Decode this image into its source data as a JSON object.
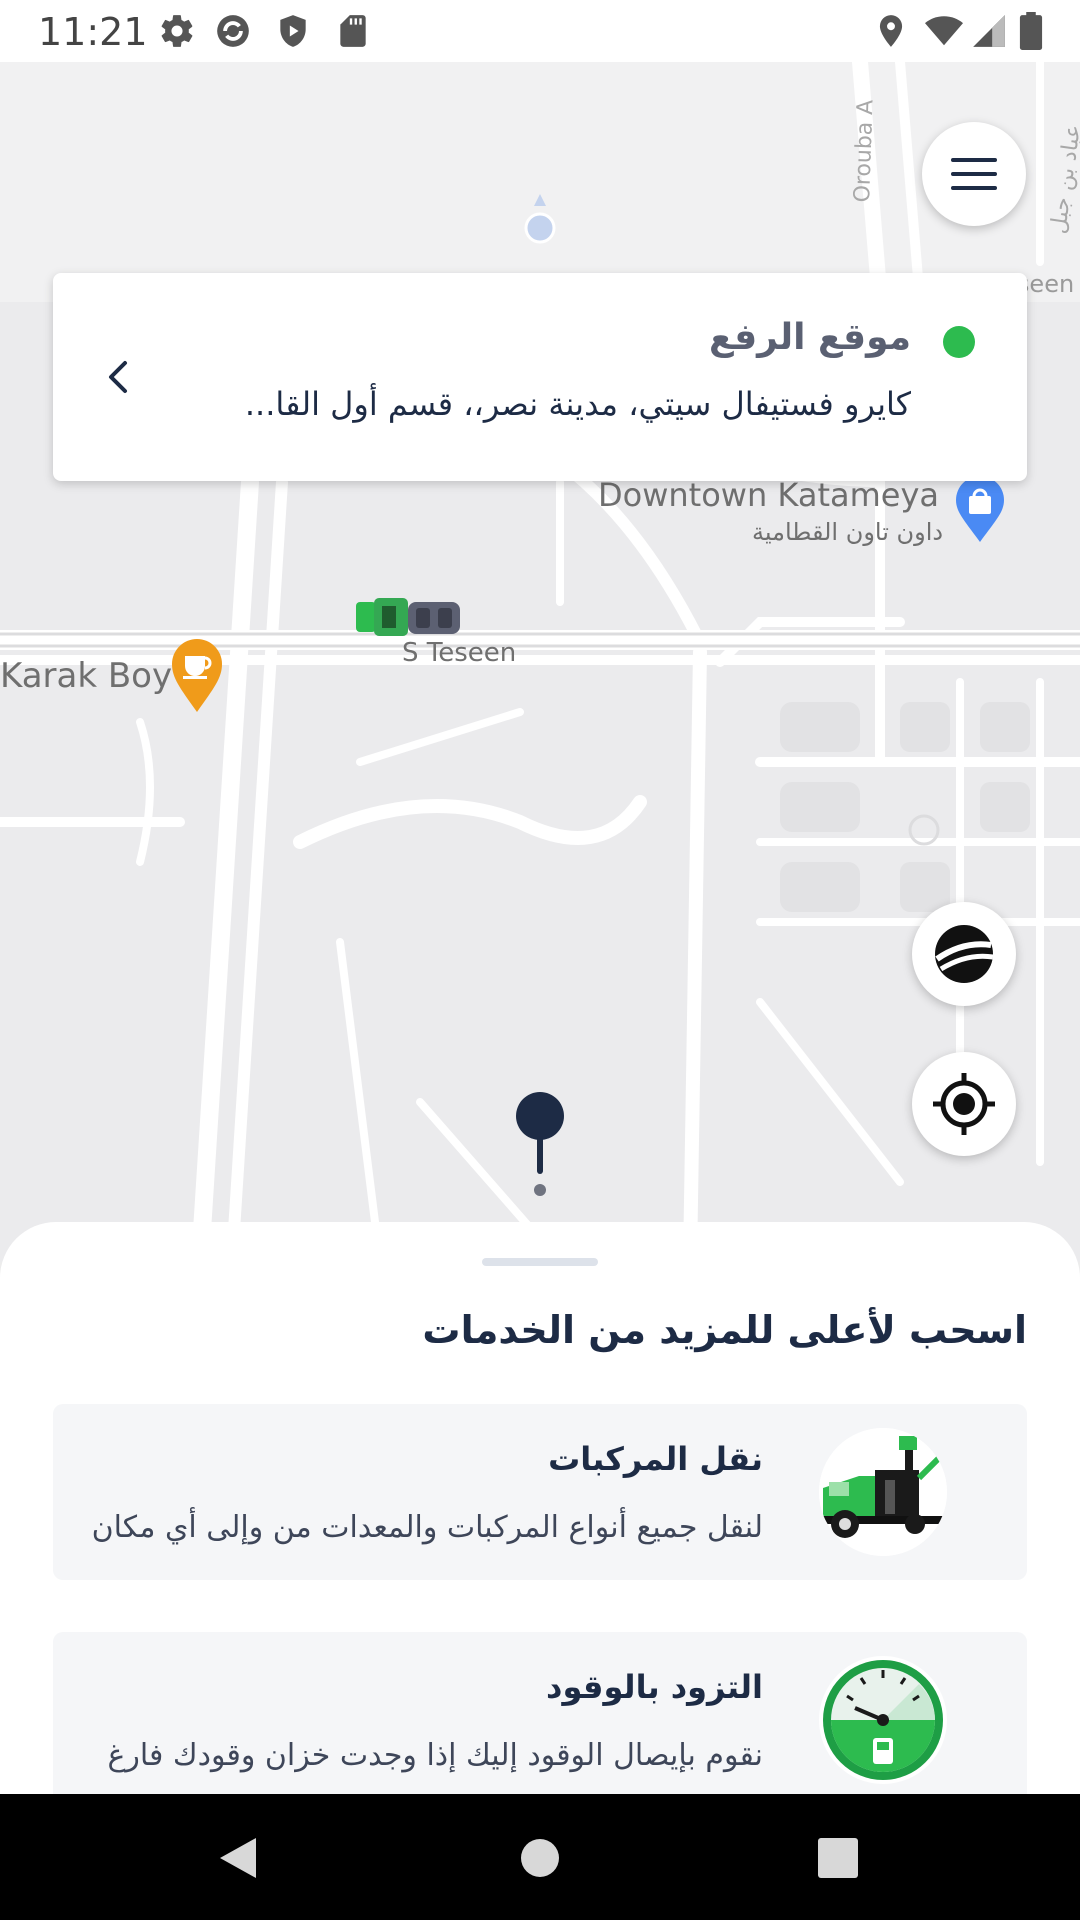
{
  "status_bar": {
    "time": "11:21",
    "left_icons": [
      "settings-icon",
      "sync-icon",
      "shield-play-icon",
      "sd-card-icon"
    ],
    "right_icons": [
      "location-icon",
      "wifi-icon",
      "signal-icon",
      "battery-icon"
    ]
  },
  "map": {
    "labels": {
      "downtown_en": "Downtown Katameya",
      "downtown_ar": "داون تاون القطامية",
      "karak": "Karak Boy",
      "s_teseen": "S Teseen",
      "n_teseen": "N Teseen",
      "orouba": "Orouba A",
      "road_ar": "عباد بن جبل"
    },
    "poi_colors": {
      "shopping": "#4a8af4",
      "cafe": "#f09b1a"
    }
  },
  "pickup": {
    "title": "موقع الرفع",
    "address": "كايرو فستيفال سيتي، مدينة نصر،، قسم أول القا...",
    "dot_color": "#2dbb4f"
  },
  "fabs": {
    "menu": "menu-icon",
    "layers": "globe-icon",
    "locate": "crosshair-icon"
  },
  "sheet": {
    "title": "اسحب لأعلى للمزيد من الخدمات",
    "services": [
      {
        "title": "نقل المركبات",
        "description": "لنقل جميع أنواع المركبات والمعدات من وإلى أي مكان",
        "icon": "tow-truck-icon"
      },
      {
        "title": "التزود بالوقود",
        "description": "نقوم بإيصال الوقود إليك إذا وجدت خزان وقودك فارغ",
        "icon": "fuel-gauge-icon"
      }
    ]
  },
  "nav": {
    "back": "back-icon",
    "home": "home-icon",
    "recents": "recents-icon"
  },
  "colors": {
    "brand_green": "#2dbb4f",
    "navy": "#1d2b45"
  }
}
